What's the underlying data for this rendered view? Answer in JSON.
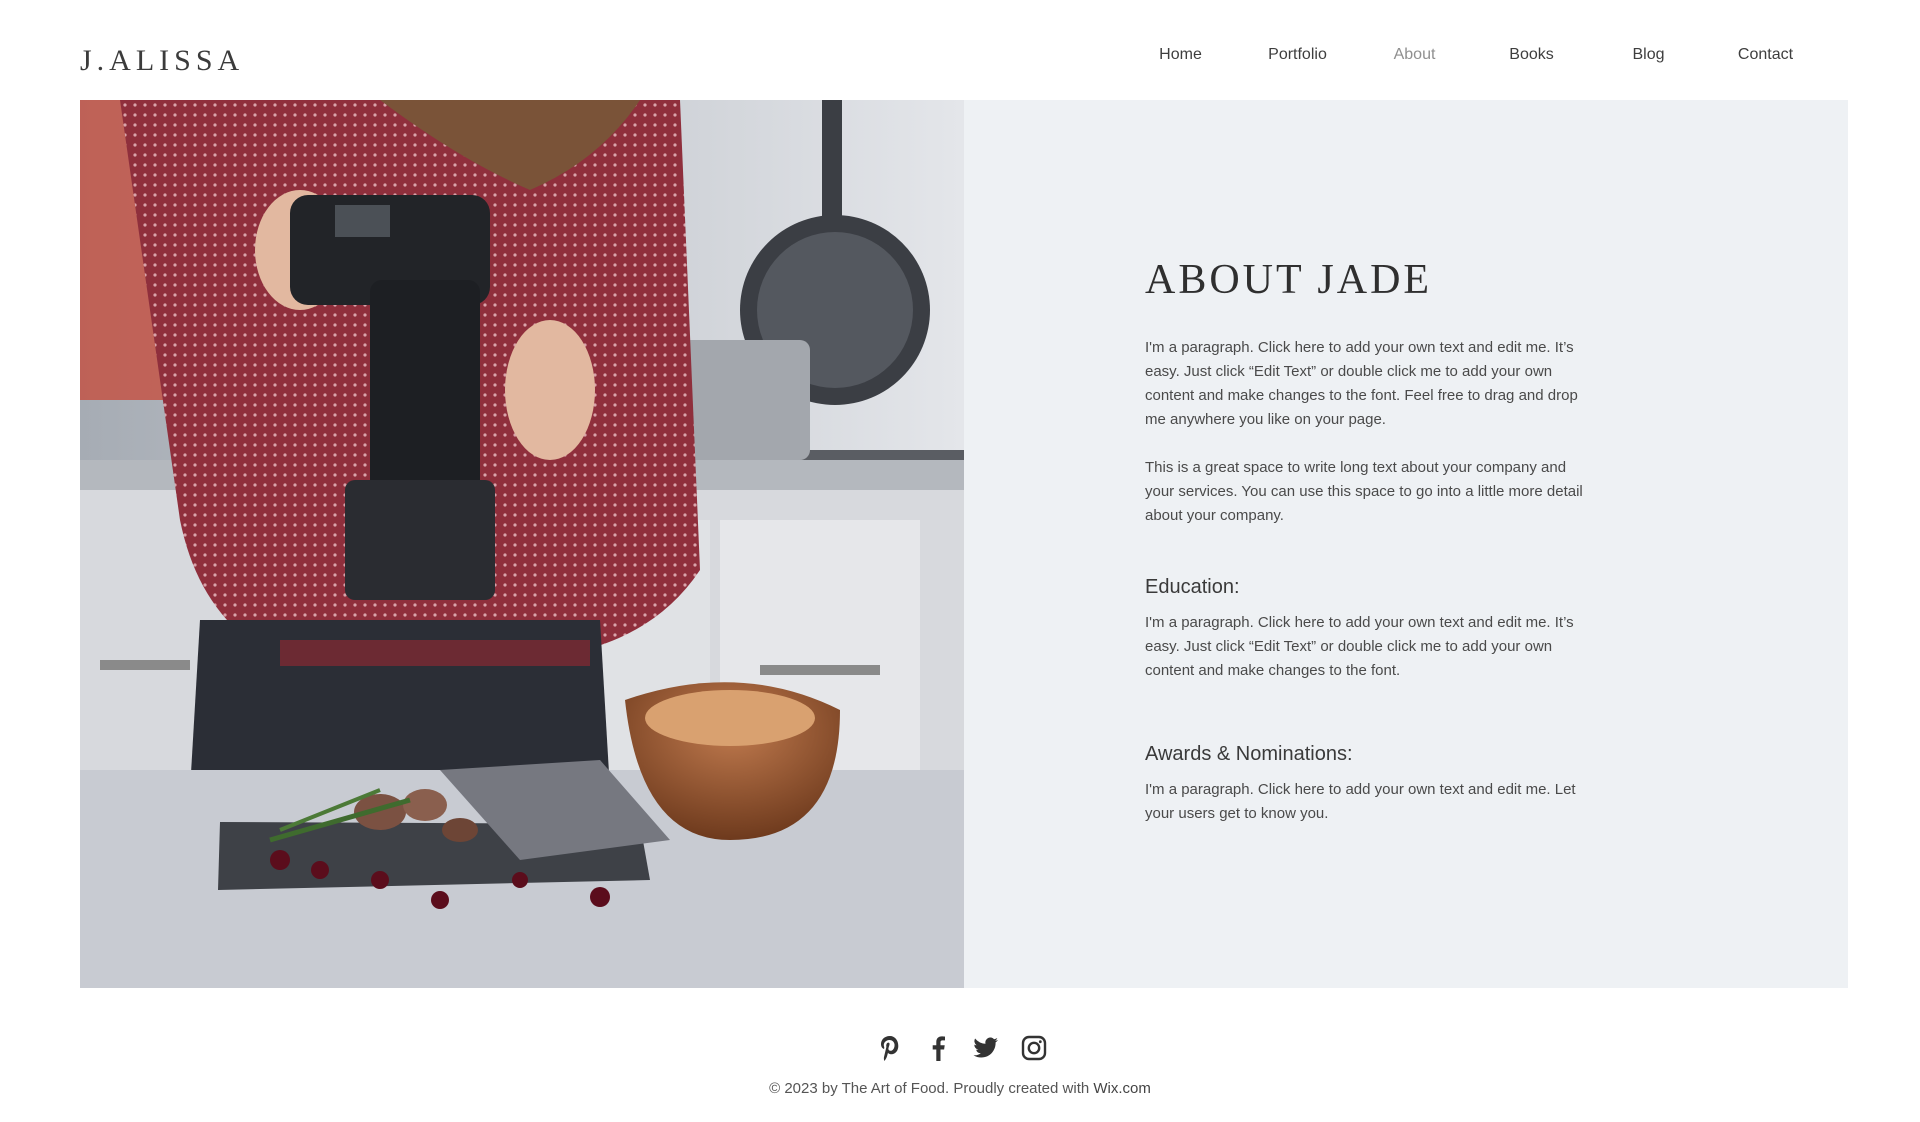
{
  "header": {
    "logo": "J.ALISSA",
    "nav": [
      "Home",
      "Portfolio",
      "About",
      "Books",
      "Blog",
      "Contact"
    ],
    "active": "About"
  },
  "about": {
    "title": "ABOUT JADE",
    "paragraph1": "I'm a paragraph. Click here to add your own text and edit me. It’s easy. Just click “Edit Text” or double click me to add your own content and make changes to the font. Feel free to drag and drop me anywhere you like on your page.",
    "paragraph2": "This is a great space to write long text about your company and your services. You can use this space to go into a little more detail about your company.",
    "education_heading": "Education:",
    "education_text": "I'm a paragraph. Click here to add your own text and edit me. It’s easy. Just click “Edit Text” or double click me to add your own content and make changes to the font.",
    "awards_heading": "Awards & Nominations:",
    "awards_text": "I'm a paragraph. Click here to add your own text and edit me. Let your users get to know you."
  },
  "footer": {
    "social_icons": [
      "pinterest-icon",
      "facebook-icon",
      "twitter-icon",
      "instagram-icon"
    ],
    "copyright_prefix": "© 2023 by The Art of Food. Proudly created with ",
    "copyright_link": "Wix.com"
  },
  "colors": {
    "panel_bg": "#eef1f4",
    "text": "#3a3a3a",
    "active_nav": "#8f8f8f"
  }
}
